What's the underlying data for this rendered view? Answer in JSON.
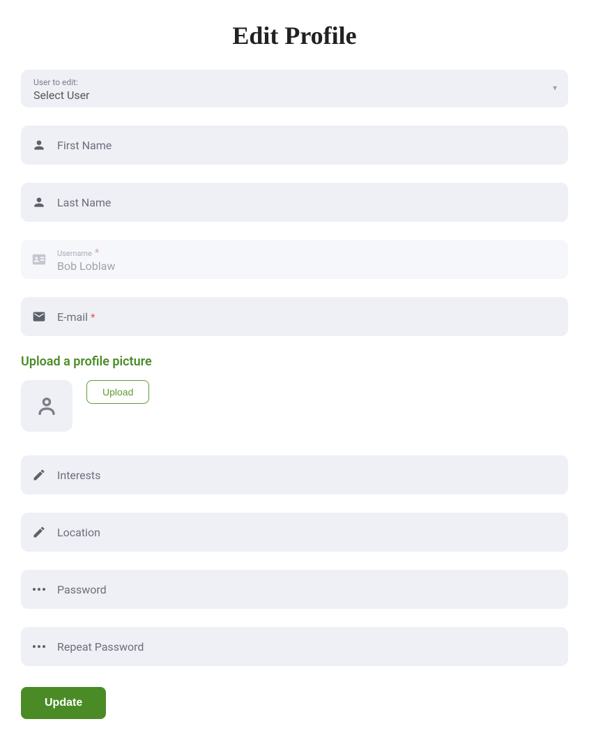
{
  "title": "Edit Profile",
  "user_select": {
    "label": "User to edit:",
    "value": "Select User"
  },
  "fields": {
    "first_name": {
      "placeholder": "First Name"
    },
    "last_name": {
      "placeholder": "Last Name"
    },
    "username": {
      "label": "Username",
      "value": "Bob Loblaw",
      "required": true
    },
    "email": {
      "placeholder": "E-mail",
      "required": true
    },
    "interests": {
      "placeholder": "Interests"
    },
    "location": {
      "placeholder": "Location"
    },
    "password": {
      "placeholder": "Password"
    },
    "repeat_password": {
      "placeholder": "Repeat Password"
    }
  },
  "upload": {
    "heading": "Upload a profile picture",
    "button": "Upload"
  },
  "submit": {
    "label": "Update"
  },
  "colors": {
    "accent": "#4b8b26",
    "field_bg": "#eef0f6"
  }
}
